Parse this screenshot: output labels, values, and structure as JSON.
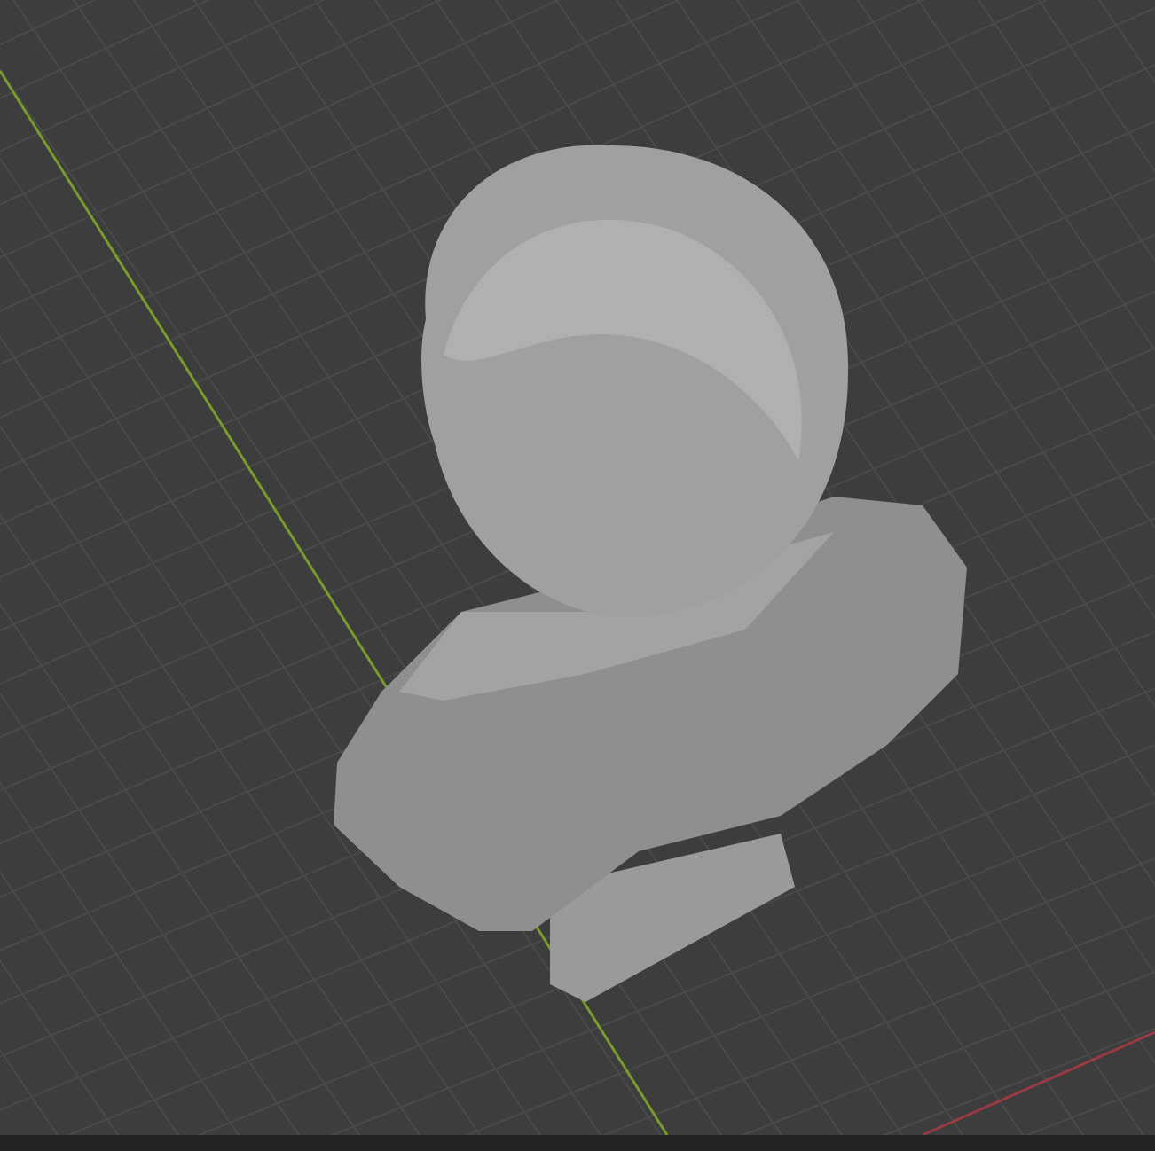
{
  "viewport": {
    "axes": [
      {
        "kind": "y",
        "color": "#7a9a2e"
      },
      {
        "kind": "x",
        "color": "#9a3a44"
      }
    ]
  }
}
